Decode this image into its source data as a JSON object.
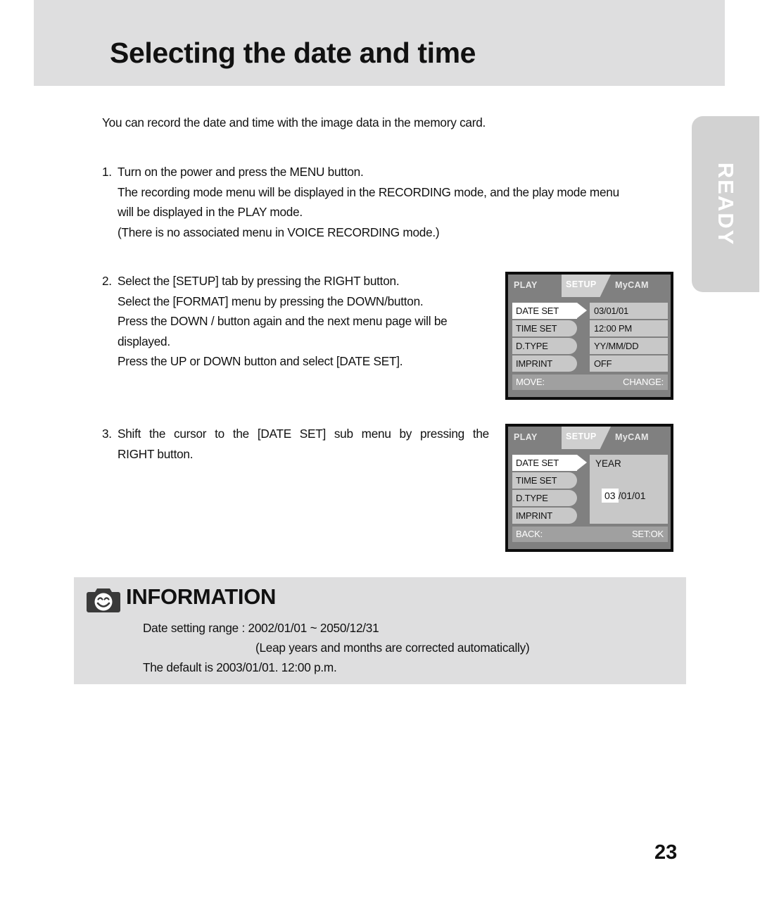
{
  "page": {
    "title": "Selecting the date and time",
    "number": "23",
    "side_tab_label": "READY"
  },
  "intro": "You can record the date and time with the image data in the memory card.",
  "steps": [
    {
      "number": "1.",
      "lines": [
        "Turn on the power and press the MENU button.",
        "The recording mode menu will be displayed in the RECORDING mode, and the play mode menu",
        "will be displayed in the PLAY mode.",
        "(There is no associated menu in VOICE RECORDING mode.)"
      ]
    },
    {
      "number": "2.",
      "lines": [
        "Select the [SETUP] tab by pressing the RIGHT button.",
        "Select the [FORMAT] menu by pressing the DOWN/button.",
        "Press the DOWN / button again and the next menu page will be",
        "displayed.",
        "Press the UP or DOWN button and select [DATE SET]."
      ]
    },
    {
      "number": "3.",
      "lines": [
        "Shift the cursor to the [DATE SET] sub menu by pressing the",
        "RIGHT button."
      ]
    }
  ],
  "lcd_screens": [
    {
      "tabs": {
        "play": "PLAY",
        "setup": "SETUP",
        "mycam": "MyCAM"
      },
      "rows": [
        {
          "label": "DATE SET",
          "value": "03/01/01",
          "selected": true
        },
        {
          "label": "TIME SET",
          "value": "12:00 PM",
          "selected": false
        },
        {
          "label": "D.TYPE",
          "value": "YY/MM/DD",
          "selected": false
        },
        {
          "label": "IMPRINT",
          "value": "OFF",
          "selected": false
        }
      ],
      "status": {
        "left": "MOVE:",
        "right": "CHANGE:"
      }
    },
    {
      "tabs": {
        "play": "PLAY",
        "setup": "SETUP",
        "mycam": "MyCAM"
      },
      "rows": [
        {
          "label": "DATE SET",
          "selected": true
        },
        {
          "label": "TIME SET",
          "selected": false
        },
        {
          "label": "D.TYPE",
          "selected": false
        },
        {
          "label": "IMPRINT",
          "selected": false
        }
      ],
      "sub_panel": {
        "title": "YEAR",
        "highlighted_value": "03",
        "rest_value": "/01/01"
      },
      "status": {
        "left": "BACK:",
        "right": "SET:OK"
      }
    }
  ],
  "information": {
    "title": "INFORMATION",
    "icon": "camera-smiley-icon",
    "lines": [
      "Date setting range : 2002/01/01 ~ 2050/12/31",
      "(Leap years and months are corrected automatically)",
      "The default is 2003/01/01. 12:00 p.m."
    ]
  },
  "colors": {
    "header_band": "#dededf",
    "lcd_background": "#808080",
    "lcd_row": "#c8c8c8",
    "lcd_selected": "#ffffff",
    "lcd_status_bar": "#a0a0a0",
    "side_tab": "#d2d2d2"
  }
}
